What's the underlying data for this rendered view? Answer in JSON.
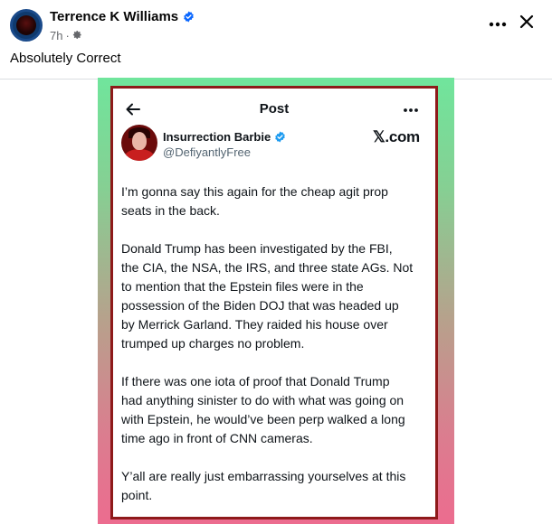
{
  "post": {
    "author_name": "Terrence K Williams",
    "time": "7h",
    "separator": "·",
    "caption": "Absolutely Correct"
  },
  "icons": {
    "verified": "verified-badge-icon",
    "privacy": "gear-icon",
    "more": "more-horizontal-icon",
    "close": "close-icon",
    "back": "arrow-left-icon"
  },
  "colors": {
    "facebook_verified": "#0866ff",
    "x_verified": "#1d9bf0",
    "card_border": "#8e1a1a",
    "gradient_top": "#70e59c",
    "gradient_bottom": "#ec6c8f"
  },
  "embedded": {
    "header_title": "Post",
    "name": "Insurrection Barbie",
    "handle": "@DefiyantlyFree",
    "brand": "𝕏.com",
    "paragraphs": [
      "I’m gonna say this again for the cheap agit prop\nseats in the back.",
      "Donald Trump has been investigated by the FBI,\nthe CIA, the NSA, the IRS, and three state AGs. Not\nto mention that the Epstein files were in the\npossession of the Biden DOJ that was headed up\nby Merrick Garland. They raided his house over\ntrumped up charges no problem.",
      "If there was one iota of proof that Donald Trump\nhad anything sinister to do with what was going on\nwith Epstein, he would’ve been perp walked a long\ntime ago in front of CNN cameras.",
      "Y’all are really just embarrassing yourselves at this\npoint."
    ]
  }
}
